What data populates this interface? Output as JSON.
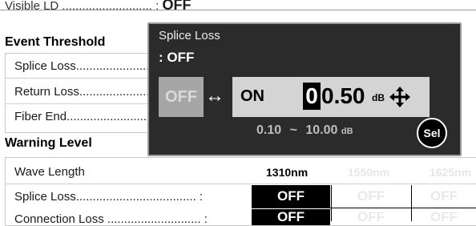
{
  "top_row": {
    "label": "Visible LD ........................... :",
    "value": "OFF"
  },
  "event_threshold": {
    "heading": "Event Threshold",
    "rows": [
      "Splice Loss.........................",
      "Return Loss.........................",
      "Fiber End..........................."
    ]
  },
  "warning_level": {
    "heading": "Warning Level",
    "column_label": "Wave Length",
    "columns": [
      "1310nm",
      "1550nm",
      "1625nm"
    ],
    "rows": [
      {
        "label": "Splice Loss.................................... :",
        "values": [
          "OFF",
          "OFF",
          "OFF"
        ]
      },
      {
        "label": "Connection Loss ............................ :",
        "values": [
          "OFF",
          "OFF",
          "OFF"
        ]
      }
    ]
  },
  "popup": {
    "title": "Splice Loss",
    "status": ":  OFF",
    "off_label": "OFF",
    "toggle_arrow": "↔",
    "on_label": "ON",
    "cursor_digit": "0",
    "rest_digits": "0.50",
    "unit": "dB",
    "range_min": "0.10",
    "range_sep": "~",
    "range_max": "10.00",
    "range_unit": "dB",
    "select_label": "Sel"
  }
}
